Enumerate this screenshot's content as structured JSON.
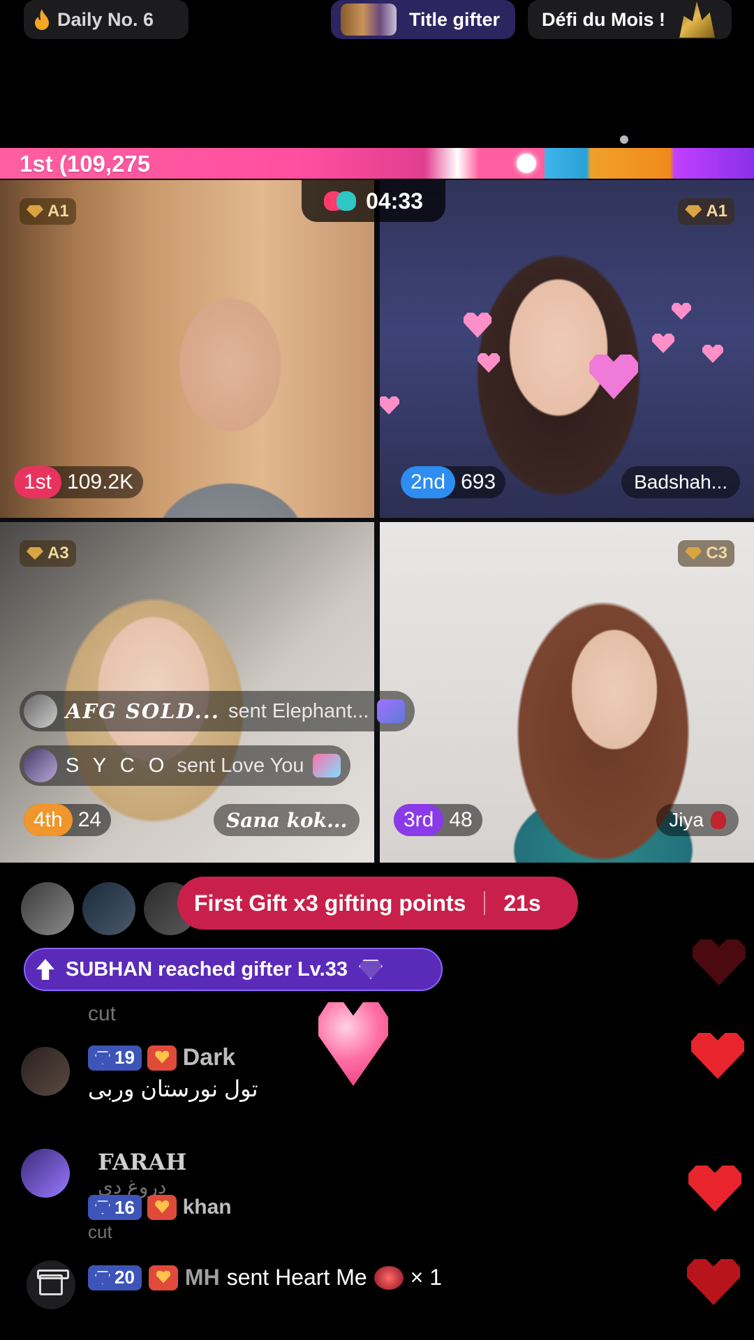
{
  "top_bar": {
    "daily_label": "Daily No. 6",
    "title_gifter_label": "Title gifter",
    "challenge_label": "Défi du Mois !"
  },
  "battle": {
    "leader_score_text": "1st (109,275",
    "timer": "04:33",
    "hosts": [
      {
        "tier": "A1",
        "position": "1st",
        "points": "109.2K",
        "name": "",
        "position_color": "#e8335f"
      },
      {
        "tier": "A1",
        "position": "2nd",
        "points": "693",
        "name": "Badshah...",
        "position_color": "#2d8df0"
      },
      {
        "tier": "A3",
        "position": "4th",
        "points": "24",
        "name": "Sana kok...",
        "position_color": "#f0962a"
      },
      {
        "tier": "C3",
        "position": "3rd",
        "points": "48",
        "name": "Jiya",
        "position_color": "#8a3ae8"
      }
    ]
  },
  "gift_notifications": [
    {
      "user": "AFG SOLD...",
      "message": "sent Elephant..."
    },
    {
      "user": "S Y C O",
      "message": "sent Love You"
    }
  ],
  "promo": {
    "text": "First Gift x3 gifting points",
    "countdown": "21s"
  },
  "level_up": {
    "text": "SUBHAN reached gifter Lv.33"
  },
  "chat": [
    {
      "level": "",
      "name": "",
      "text": "cut"
    },
    {
      "level": "19",
      "name": "Dark",
      "text": "تول نورستان وربی"
    },
    {
      "level": "",
      "name": "FARAH",
      "text": "دروغ دی"
    },
    {
      "level": "16",
      "name": "khan",
      "text": "cut"
    }
  ],
  "last_gift": {
    "level": "20",
    "user": "MH",
    "text": "sent Heart Me",
    "count": "× 1"
  },
  "colors": {
    "accent_pink": "#ff4fa0",
    "promo_red": "#c8204a",
    "levelup_purple": "#5a2bb8",
    "heart_red": "#e8242c"
  }
}
